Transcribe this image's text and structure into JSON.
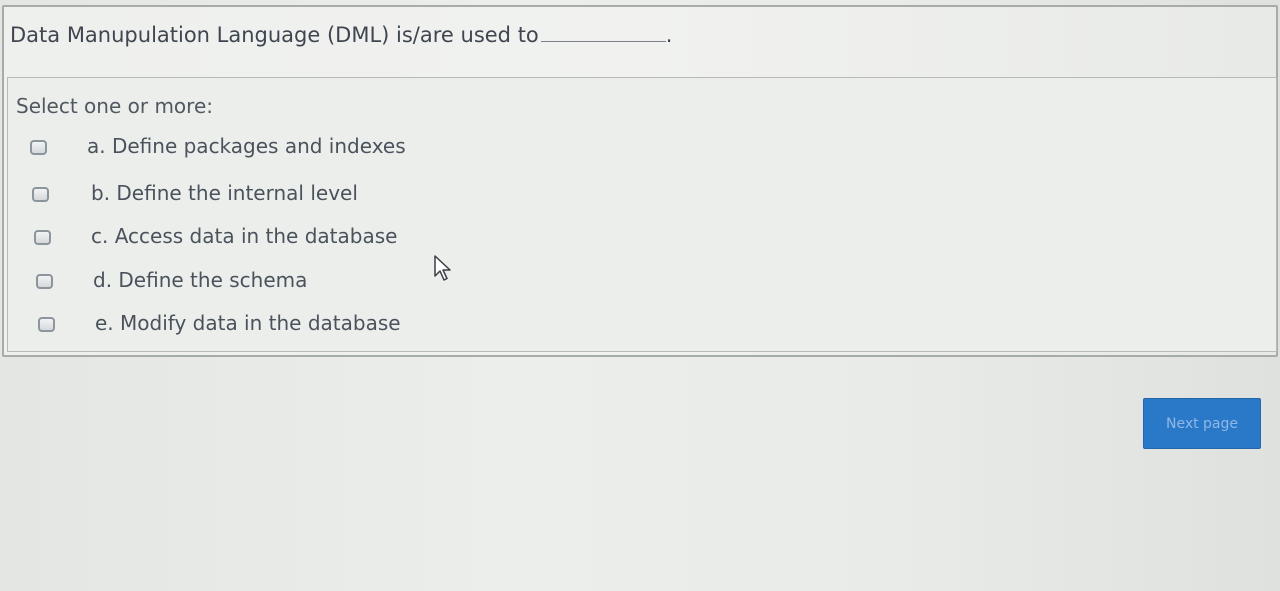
{
  "question": {
    "text": "Data Manupulation Language (DML) is/are used to",
    "suffix": "."
  },
  "answer_prompt": "Select one or more:",
  "options": [
    {
      "label": "a. Define packages and indexes",
      "checked": false
    },
    {
      "label": "b. Define the  internal level",
      "checked": false
    },
    {
      "label": "c. Access data in the database",
      "checked": false
    },
    {
      "label": "d. Define the schema",
      "checked": false
    },
    {
      "label": "e. Modify data in the database",
      "checked": false
    }
  ],
  "navigation": {
    "next_label": "Next page"
  },
  "colors": {
    "button": "#2a79c9",
    "text": "#4a4f55"
  }
}
